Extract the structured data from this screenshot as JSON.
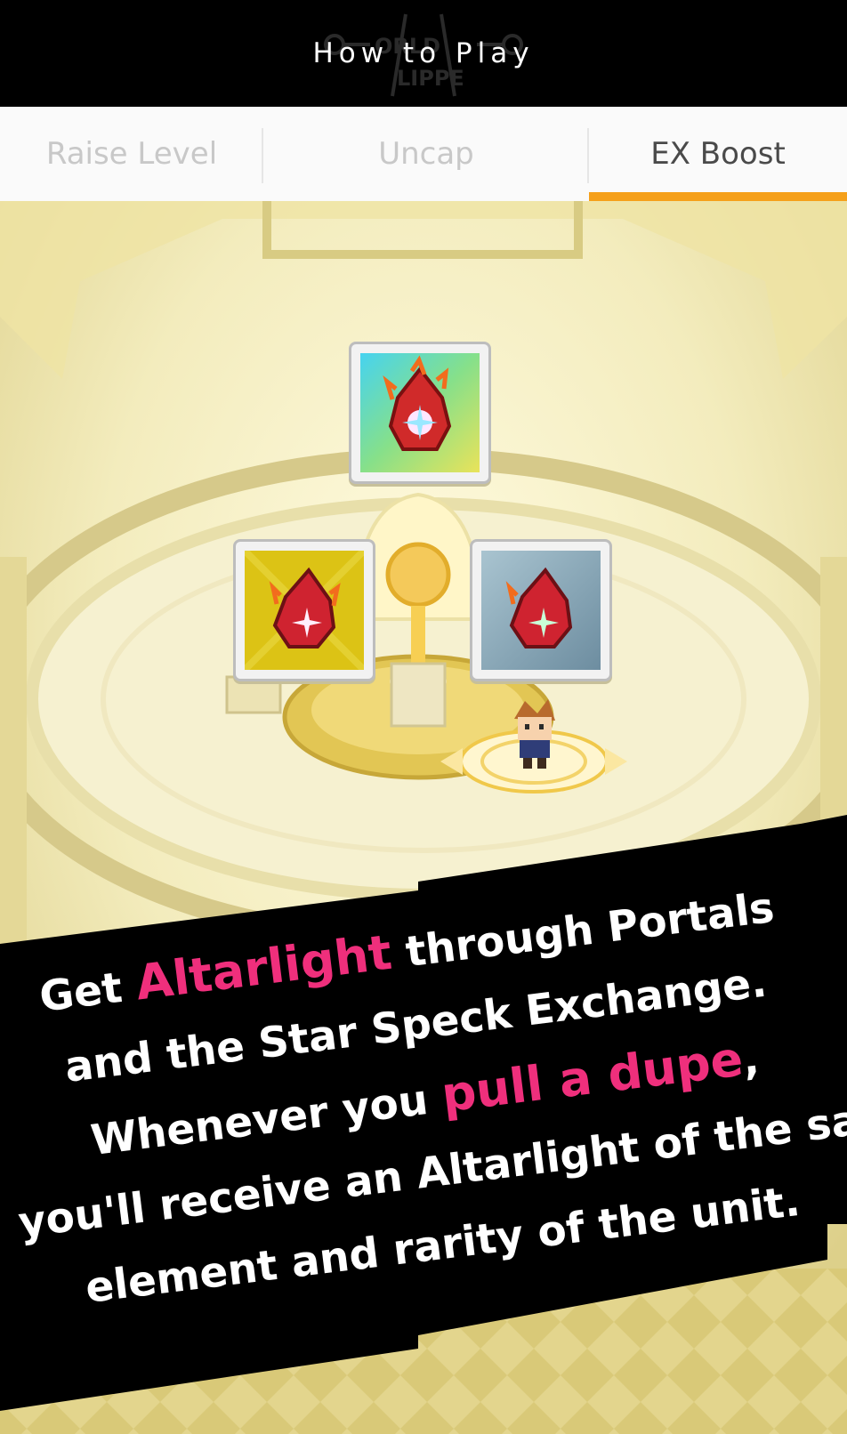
{
  "header": {
    "title": "How to Play",
    "logo_text": "WORLD FLIPPER"
  },
  "tabs": [
    {
      "label": "Raise Level",
      "active": false
    },
    {
      "label": "Uncap",
      "active": false
    },
    {
      "label": "EX Boost",
      "active": true
    }
  ],
  "caption": {
    "line1_a": "Get ",
    "line1_hl": "Altarlight",
    "line1_b": " through Portals",
    "line2": "and the Star Speck Exchange.",
    "line3_a": "Whenever you ",
    "line3_hl": "pull a dupe",
    "line3_b": ",",
    "line4": "you'll receive an Altarlight of the same",
    "line5": "element and rarity of the unit."
  },
  "scene": {
    "items": [
      {
        "name": "altarlight-rainbow-icon",
        "rarity": "rainbow"
      },
      {
        "name": "altarlight-gold-icon",
        "rarity": "gold"
      },
      {
        "name": "altarlight-silver-icon",
        "rarity": "silver"
      }
    ]
  },
  "colors": {
    "accent_tab": "#f5a01a",
    "highlight_text": "#ef2f7c",
    "banner": "#000000"
  }
}
